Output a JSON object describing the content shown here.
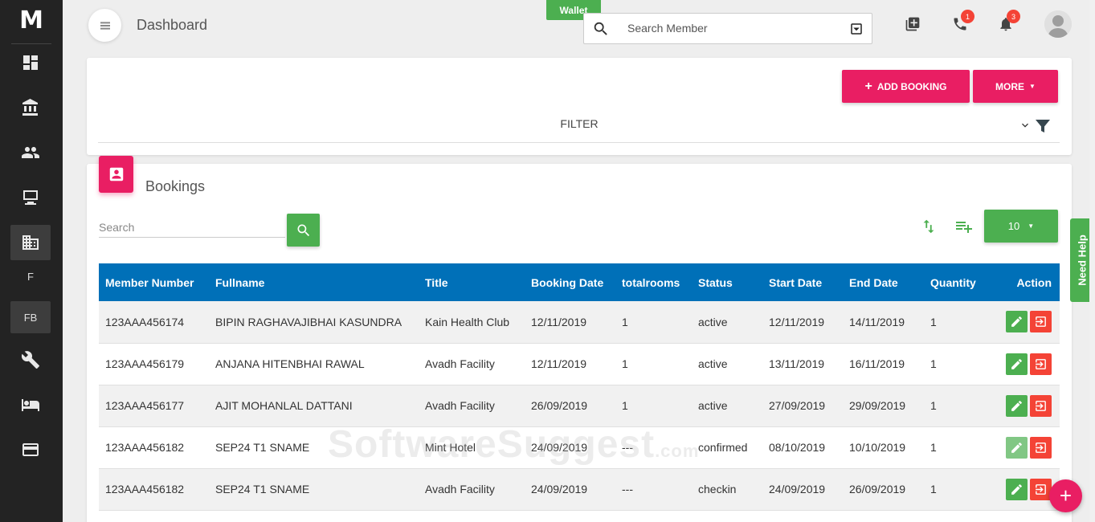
{
  "app": {
    "logo": "M",
    "page_title": "Dashboard"
  },
  "sidebar": {
    "items": [
      {
        "icon": "dashboard-icon"
      },
      {
        "icon": "bank-icon"
      },
      {
        "icon": "users-icon"
      },
      {
        "icon": "monitor-icon"
      },
      {
        "icon": "building-icon",
        "active": true
      },
      {
        "label": "F"
      },
      {
        "label": "FB"
      },
      {
        "icon": "wrench-icon"
      },
      {
        "icon": "bed-icon"
      },
      {
        "icon": "credit-card-icon"
      }
    ]
  },
  "topbar": {
    "wallet_label": "Wallet",
    "search_placeholder": "Search Member",
    "call_badge": "1",
    "notif_badge": "3"
  },
  "filter": {
    "add_booking_label": "ADD BOOKING",
    "more_label": "MORE",
    "filter_label": "FILTER"
  },
  "bookings": {
    "title": "Bookings",
    "search_placeholder": "Search",
    "page_size": "10",
    "columns": [
      "Member Number",
      "Fullname",
      "Title",
      "Booking Date",
      "totalrooms",
      "Status",
      "Start Date",
      "End Date",
      "Quantity",
      "Action"
    ],
    "rows": [
      [
        "123AAA456174",
        "BIPIN RAGHAVAJIBHAI KASUNDRA",
        "Kain Health Club",
        "12/11/2019",
        "1",
        "active",
        "12/11/2019",
        "14/11/2019",
        "1"
      ],
      [
        "123AAA456179",
        "ANJANA HITENBHAI RAWAL",
        "Avadh Facility",
        "12/11/2019",
        "1",
        "active",
        "13/11/2019",
        "16/11/2019",
        "1"
      ],
      [
        "123AAA456177",
        "AJIT MOHANLAL DATTANI",
        "Avadh Facility",
        "26/09/2019",
        "1",
        "active",
        "27/09/2019",
        "29/09/2019",
        "1"
      ],
      [
        "123AAA456182",
        "SEP24 T1 SNAME",
        "Mint Hotel",
        "24/09/2019",
        "---",
        "confirmed",
        "08/10/2019",
        "10/10/2019",
        "1"
      ],
      [
        "123AAA456182",
        "SEP24 T1 SNAME",
        "Avadh Facility",
        "24/09/2019",
        "---",
        "checkin",
        "24/09/2019",
        "26/09/2019",
        "1"
      ]
    ]
  },
  "need_help_label": "Need Help",
  "watermark": {
    "main": "SoftwareSuggest",
    "suffix": ".com"
  }
}
